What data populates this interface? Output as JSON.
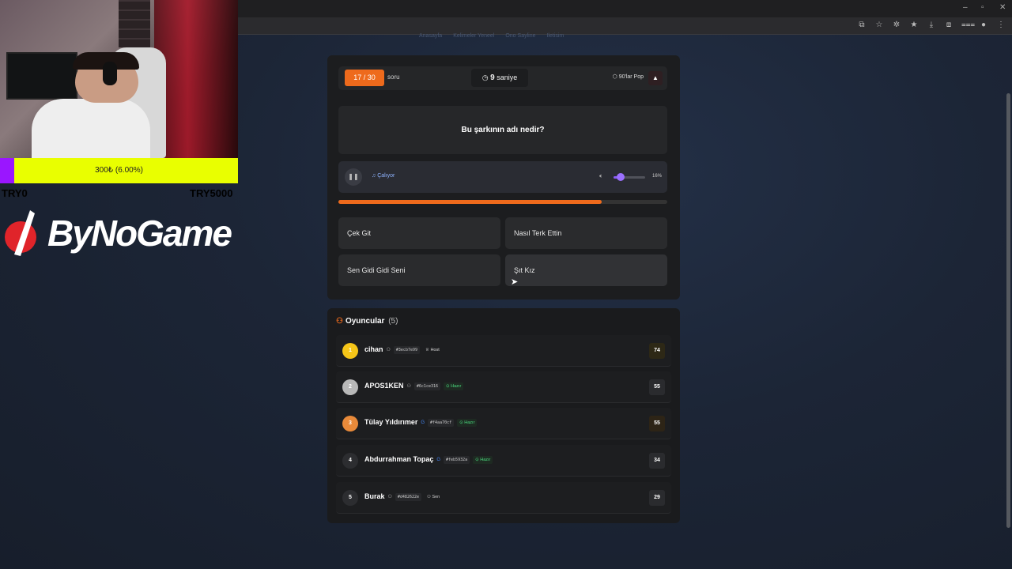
{
  "browser": {
    "icons": [
      "minimize-icon",
      "maximize-icon",
      "close-icon"
    ],
    "nav_links": [
      "Anasayfa",
      "Kelimeler Yeneel",
      "Ono Sayline",
      "Iletisim"
    ]
  },
  "stream": {
    "donation_text": "300₺ (6.00%)",
    "donation_progress": 0.06,
    "min_label": "TRY0",
    "max_label": "TRY5000",
    "brand": "ByNoGame",
    "colors": {
      "bar": "#e9ff00",
      "fill": "#9a16ff"
    }
  },
  "game": {
    "counter": "17 / 30",
    "counter_label": "soru",
    "timer_value": "9",
    "timer_label": "saniye",
    "category": "90'lar Pop",
    "question": "Bu şarkının adı nedir?",
    "playing_label": "♫ Çalıyor",
    "volume_pct": "16%",
    "volume_level": 0.16,
    "song_progress": 0.8,
    "answers": [
      "Çek Git",
      "Nasıl Terk Ettin",
      "Sen Gidi Gidi Seni",
      "Şıt Kız"
    ],
    "accent": "#ee6a1c"
  },
  "players": {
    "title": "Oyuncular",
    "count": "(5)",
    "list": [
      {
        "rank": "1",
        "name": "cihan",
        "id": "#3ecb7e99",
        "badge": "♕ Host",
        "badge_type": "host",
        "score": "74",
        "rank_color": "#f5c518"
      },
      {
        "rank": "2",
        "name": "APOS1KEN",
        "id": "#6c1ce316",
        "badge": "⊙ Hazır",
        "badge_type": "ready",
        "score": "55",
        "rank_color": "#b8b8b8"
      },
      {
        "rank": "3",
        "name": "Tülay Yıldırımer",
        "id": "#f4aa70cf",
        "badge": "⊙ Hazır",
        "badge_type": "ready",
        "score": "55",
        "rank_color": "#e88a3a"
      },
      {
        "rank": "4",
        "name": "Abdurrahman Topaç",
        "id": "#feb5932a",
        "badge": "⊙ Hazır",
        "badge_type": "ready",
        "score": "34",
        "rank_color": "#2c2d30"
      },
      {
        "rank": "5",
        "name": "Burak",
        "id": "#d482622e",
        "badge": "⚇ Sen",
        "badge_type": "you",
        "score": "29",
        "rank_color": "#2c2d30"
      }
    ]
  }
}
